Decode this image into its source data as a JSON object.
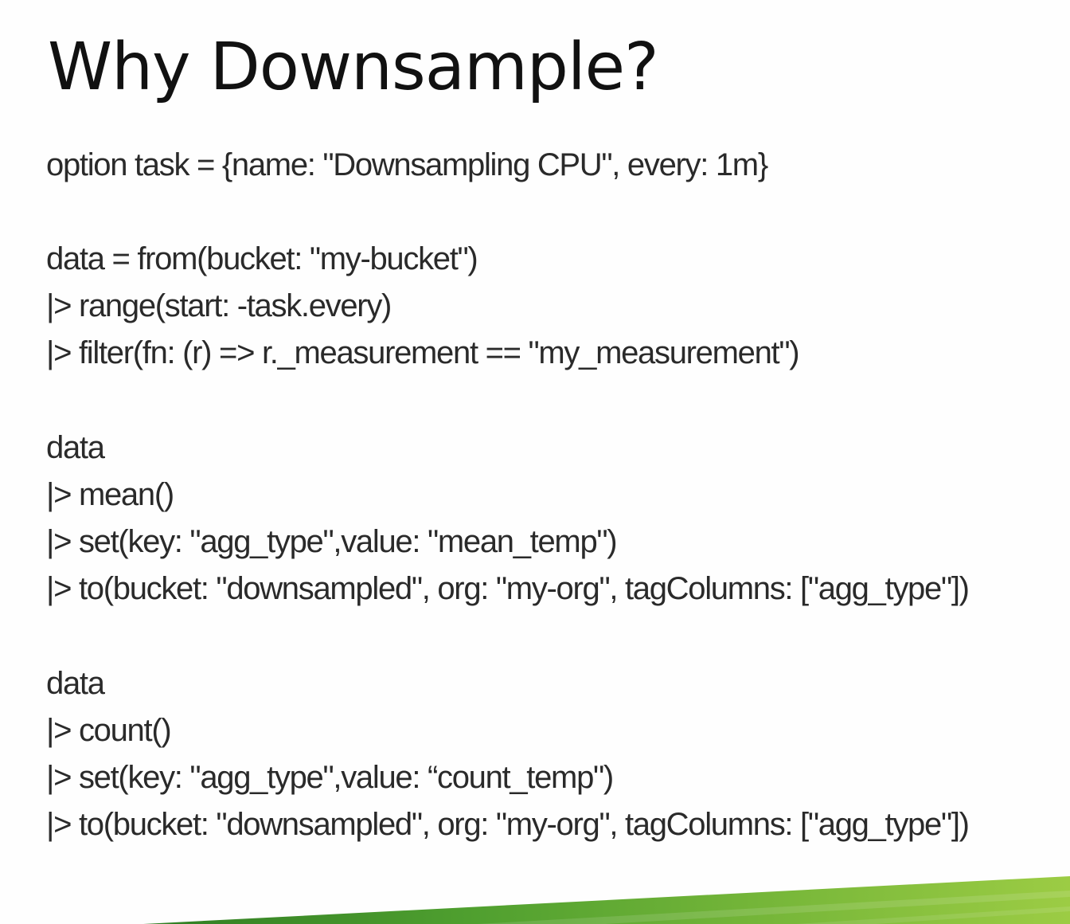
{
  "slide": {
    "title": "Why Downsample?",
    "code_lines": [
      "option task = {name: \"Downsampling CPU\", every: 1m}",
      "data = from(bucket: \"my-bucket\")",
      "|> range(start: -task.every)",
      "|> filter(fn: (r) => r._measurement == \"my_measurement\")",
      "data",
      "|> mean()",
      "|> set(key: \"agg_type\",value: \"mean_temp\")",
      "|> to(bucket: \"downsampled\", org: \"my-org\", tagColumns: [\"agg_type\"])",
      "data",
      "|> count()",
      "|> set(key: \"agg_type\",value: “count_temp\")",
      "|> to(bucket: \"downsampled\", org: \"my-org\", tagColumns: [\"agg_type\"])"
    ]
  },
  "colors": {
    "background": "#fefefe",
    "title_text": "#111111",
    "code_text": "#2a2a2a",
    "accent_green_dark": "#3f8f2a",
    "accent_green_light": "#8cc63f"
  }
}
